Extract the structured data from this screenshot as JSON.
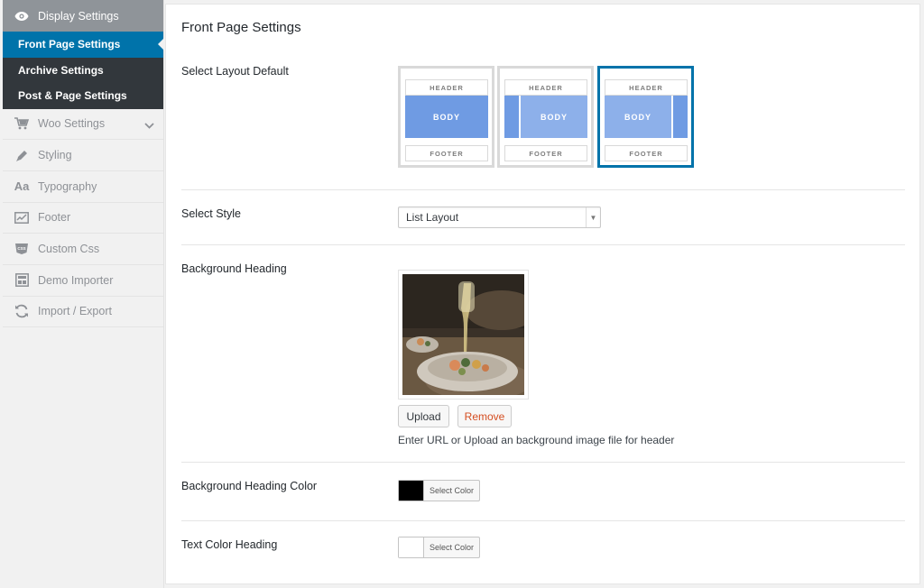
{
  "sidebar": {
    "header": {
      "label": "Display Settings",
      "icon": "eye-icon"
    },
    "subitems": [
      {
        "label": "Front Page Settings",
        "active": true
      },
      {
        "label": "Archive Settings",
        "active": false
      },
      {
        "label": "Post & Page Settings",
        "active": false
      }
    ],
    "items": [
      {
        "label": "Woo Settings",
        "icon": "cart-icon"
      },
      {
        "label": "Styling",
        "icon": "pencil-icon"
      },
      {
        "label": "Typography",
        "icon": "Aa"
      },
      {
        "label": "Footer",
        "icon": "chart-icon"
      },
      {
        "label": "Custom Css",
        "icon": "css-icon"
      },
      {
        "label": "Demo Importer",
        "icon": "importer-icon"
      },
      {
        "label": "Import / Export",
        "icon": "refresh-icon"
      }
    ]
  },
  "main": {
    "title": "Front Page Settings",
    "layout": {
      "label": "Select Layout Default",
      "options": [
        {
          "header": "HEADER",
          "body": "BODY",
          "footer": "FOOTER",
          "variant": "full",
          "selected": false
        },
        {
          "header": "HEADER",
          "body": "BODY",
          "footer": "FOOTER",
          "variant": "left-sidebar",
          "selected": false
        },
        {
          "header": "HEADER",
          "body": "BODY",
          "footer": "FOOTER",
          "variant": "right-sidebar",
          "selected": true
        }
      ]
    },
    "style": {
      "label": "Select Style",
      "value": "List Layout"
    },
    "background": {
      "label": "Background Heading",
      "upload_label": "Upload",
      "remove_label": "Remove",
      "hint": "Enter URL or Upload an background image file for header"
    },
    "bg_color": {
      "label": "Background Heading Color",
      "button_label": "Select Color",
      "swatch": "#000000"
    },
    "text_color": {
      "label": "Text Color Heading",
      "button_label": "Select Color",
      "swatch": "#ffffff"
    }
  },
  "colors": {
    "accent": "#0073aa",
    "sidebar_dark": "#32373c",
    "sidebar_header": "#8f9499",
    "remove_text": "#d54e21",
    "layout_body": "#6f9be3"
  }
}
